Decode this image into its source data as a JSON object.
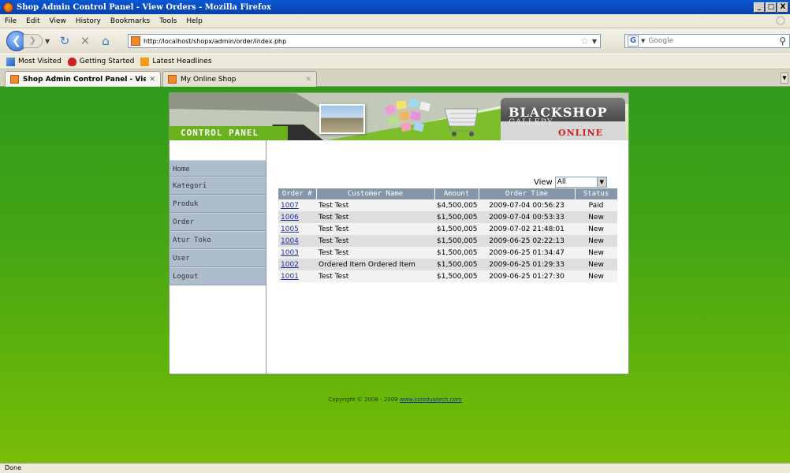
{
  "window": {
    "title": "Shop Admin Control Panel - View Orders - Mozilla Firefox",
    "buttons": [
      "_",
      "□",
      "X"
    ]
  },
  "menu": [
    "File",
    "Edit",
    "View",
    "History",
    "Bookmarks",
    "Tools",
    "Help"
  ],
  "navigation": {
    "url": "http://localhost/shopx/admin/order/index.php",
    "search_placeholder": "Google"
  },
  "bookmarks": [
    "Most Visited",
    "Getting Started",
    "Latest Headlines"
  ],
  "tabs": [
    {
      "label": "Shop Admin Control Panel - View ...",
      "active": true
    },
    {
      "label": "My Online Shop",
      "active": false
    }
  ],
  "banner": {
    "control_panel": "CONTROL PANEL",
    "brand_title": "BLACKSHOP",
    "brand_sub": "GALLERY",
    "brand_online": "ONLINE"
  },
  "sidebar": {
    "items": [
      "Home",
      "Kategori",
      "Produk",
      "Order",
      "Atur Toko",
      "User",
      "Logout"
    ]
  },
  "filter": {
    "label": "View",
    "selected": "All"
  },
  "orders": {
    "columns": [
      "Order #",
      "Customer Name",
      "Amount",
      "Order Time",
      "Status"
    ],
    "rows": [
      {
        "id": "1007",
        "customer": "Test Test",
        "amount": "$4,500,005",
        "time": "2009-07-04 00:56:23",
        "status": "Paid"
      },
      {
        "id": "1006",
        "customer": "Test Test",
        "amount": "$1,500,005",
        "time": "2009-07-04 00:53:33",
        "status": "New"
      },
      {
        "id": "1005",
        "customer": "Test Test",
        "amount": "$1,500,005",
        "time": "2009-07-02 21:48:01",
        "status": "New"
      },
      {
        "id": "1004",
        "customer": "Test Test",
        "amount": "$1,500,005",
        "time": "2009-06-25 02:22:13",
        "status": "New"
      },
      {
        "id": "1003",
        "customer": "Test Test",
        "amount": "$1,500,005",
        "time": "2009-06-25 01:34:47",
        "status": "New"
      },
      {
        "id": "1002",
        "customer": "Ordered Item Ordered Item",
        "amount": "$1,500,005",
        "time": "2009-06-25 01:29:33",
        "status": "New"
      },
      {
        "id": "1001",
        "customer": "Test Test",
        "amount": "$1,500,005",
        "time": "2009-06-25 01:27:30",
        "status": "New"
      }
    ]
  },
  "footer": {
    "copyright": "Copyright © 2008 - 2009 ",
    "link": "www.koloduatech.com"
  },
  "status_bar": "Done",
  "colors": {
    "page_bg_top": "#2f9b1c",
    "page_bg_bottom": "#78bd06",
    "table_header": "#8496a8",
    "sidebar_item": "#aebdcc",
    "online_red": "#d21b1b"
  }
}
